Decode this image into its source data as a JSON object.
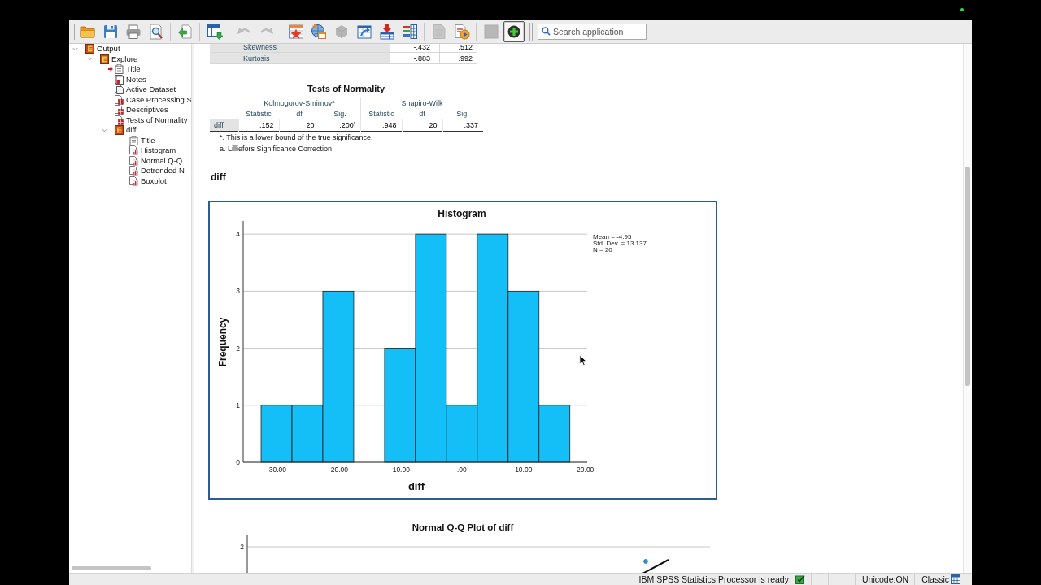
{
  "toolbar": {
    "groups": [
      [
        {
          "kind": "folder",
          "disabled": false,
          "on": false
        },
        {
          "kind": "floppy",
          "disabled": false,
          "on": false
        },
        {
          "kind": "printer",
          "disabled": false,
          "on": false
        },
        {
          "kind": "preview",
          "disabled": false,
          "on": false
        }
      ],
      [
        {
          "kind": "export",
          "disabled": false,
          "on": false
        }
      ],
      [
        {
          "kind": "datawindow",
          "disabled": false,
          "on": false
        }
      ],
      [
        {
          "kind": "undo",
          "disabled": true,
          "on": false
        },
        {
          "kind": "redo",
          "disabled": true,
          "on": false
        }
      ],
      [
        {
          "kind": "startable",
          "disabled": false,
          "on": false
        },
        {
          "kind": "globetable",
          "disabled": false,
          "on": false
        },
        {
          "kind": "block",
          "disabled": true,
          "on": false
        },
        {
          "kind": "arrowtable",
          "disabled": false,
          "on": false
        },
        {
          "kind": "inserttable",
          "disabled": false,
          "on": false
        },
        {
          "kind": "bartable",
          "disabled": false,
          "on": false
        }
      ],
      [
        {
          "kind": "document",
          "disabled": true,
          "on": false
        },
        {
          "kind": "playdoc",
          "disabled": false,
          "on": false
        }
      ],
      [
        {
          "kind": "square",
          "disabled": true,
          "on": false
        },
        {
          "kind": "plus",
          "disabled": false,
          "on": true
        }
      ]
    ],
    "search": {
      "placeholder": "Search application"
    }
  },
  "outline": {
    "tree": [
      {
        "label": "Output",
        "kind": "folder",
        "expanded": true,
        "current": false,
        "children": [
          {
            "label": "Explore",
            "kind": "folder",
            "expanded": true,
            "current": false,
            "children": [
              {
                "label": "Title",
                "kind": "heading",
                "current": true
              },
              {
                "label": "Notes",
                "kind": "notes",
                "current": false
              },
              {
                "label": "Active Dataset",
                "kind": "log",
                "current": false
              },
              {
                "label": "Case Processing S",
                "kind": "table",
                "current": false
              },
              {
                "label": "Descriptives",
                "kind": "table",
                "current": false
              },
              {
                "label": "Tests of Normality",
                "kind": "table",
                "current": false
              },
              {
                "label": "diff",
                "kind": "folder",
                "expanded": true,
                "current": false,
                "children": [
                  {
                    "label": "Title",
                    "kind": "heading",
                    "current": false
                  },
                  {
                    "label": "Histogram",
                    "kind": "chart",
                    "current": false
                  },
                  {
                    "label": "Normal Q-Q",
                    "kind": "chart",
                    "current": false
                  },
                  {
                    "label": "Detrended N",
                    "kind": "chart",
                    "current": false
                  },
                  {
                    "label": "Boxplot",
                    "kind": "chart",
                    "current": false
                  }
                ]
              }
            ]
          }
        ]
      }
    ]
  },
  "output": {
    "descriptives_rows": [
      {
        "label": "Skewness",
        "cells": [
          "-.432",
          ".512"
        ]
      },
      {
        "label": "Kurtosis",
        "cells": [
          "-.883",
          ".992"
        ]
      }
    ],
    "tests_of_normality": {
      "title": "Tests of Normality",
      "groups": [
        {
          "label": "Kolmogorov-Smirnov$^{a}$",
          "columns": [
            "Statistic",
            "df",
            "Sig."
          ]
        },
        {
          "label": "Shapiro-Wilk",
          "columns": [
            "Statistic",
            "df",
            "Sig."
          ]
        }
      ],
      "rows": [
        {
          "label": "diff",
          "cells": [
            ".152",
            "20",
            ".200$^{*}$",
            ".948",
            "20",
            ".337"
          ]
        }
      ],
      "footnotes": [
        "*. This is a lower bound of the true significance.",
        "a. Lilliefors Significance Correction"
      ]
    },
    "section_heading": "diff",
    "histogram": {
      "chart_data": {
        "type": "histogram",
        "title": "Histogram",
        "xlabel": "diff",
        "ylabel": "Frequency",
        "bins": [
          -32.5,
          -27.5,
          -22.5,
          -17.5,
          -12.5,
          -7.5,
          -2.5,
          2.5,
          7.5,
          12.5,
          17.5
        ],
        "values": [
          1,
          1,
          3,
          0,
          2,
          4,
          1,
          4,
          3,
          1
        ],
        "color": "#14bef6",
        "xlim": [
          -35.4,
          20.3
        ],
        "ylim": [
          0,
          4.23
        ],
        "xticks": [
          {
            "value": -30,
            "label": "-30.00"
          },
          {
            "value": -20,
            "label": "-20.00"
          },
          {
            "value": -10,
            "label": "-10.00"
          },
          {
            "value": 0,
            "label": ".00"
          },
          {
            "value": 10,
            "label": "10.00"
          },
          {
            "value": 20,
            "label": "20.00"
          }
        ],
        "yticks": [
          0,
          1,
          2,
          3,
          4
        ],
        "grid": "y",
        "annotations": [
          "Mean = -4.95",
          "Std. Dev. = 13.137",
          "N = 20"
        ]
      }
    },
    "qq_plot": {
      "title": "Normal Q-Q Plot of diff",
      "tick_label": "2"
    }
  },
  "status_bar": {
    "message": "IBM SPSS Statistics Processor is ready",
    "encoding": "Unicode:ON",
    "mode": "Classic"
  }
}
